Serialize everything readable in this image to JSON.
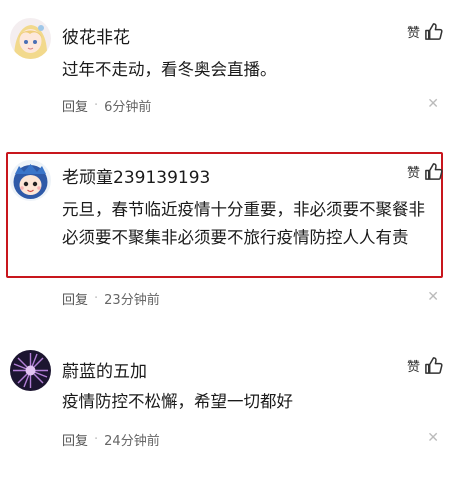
{
  "comments": [
    {
      "username": "彼花非花",
      "like_label": "赞",
      "content": "过年不走动，看冬奥会直播。",
      "reply_label": "回复",
      "separator": "·",
      "time": "6分钟前",
      "close_glyph": "✕",
      "avatar_icon": "anime-girl-avatar-icon"
    },
    {
      "username": "老顽童239139193",
      "like_label": "赞",
      "content": "元旦，春节临近疫情十分重要，非必须要不聚餐非必须要不聚集非必须要不旅行疫情防控人人有责",
      "reply_label": "回复",
      "separator": "·",
      "time": "23分钟前",
      "close_glyph": "✕",
      "avatar_icon": "mascot-avatar-icon",
      "highlighted": true,
      "highlight_color": "#c8161d"
    },
    {
      "username": "蔚蓝的五加",
      "like_label": "赞",
      "content": "疫情防控不松懈，希望一切都好",
      "reply_label": "回复",
      "separator": "·",
      "time": "24分钟前",
      "close_glyph": "✕",
      "avatar_icon": "purple-flower-avatar-icon"
    }
  ]
}
